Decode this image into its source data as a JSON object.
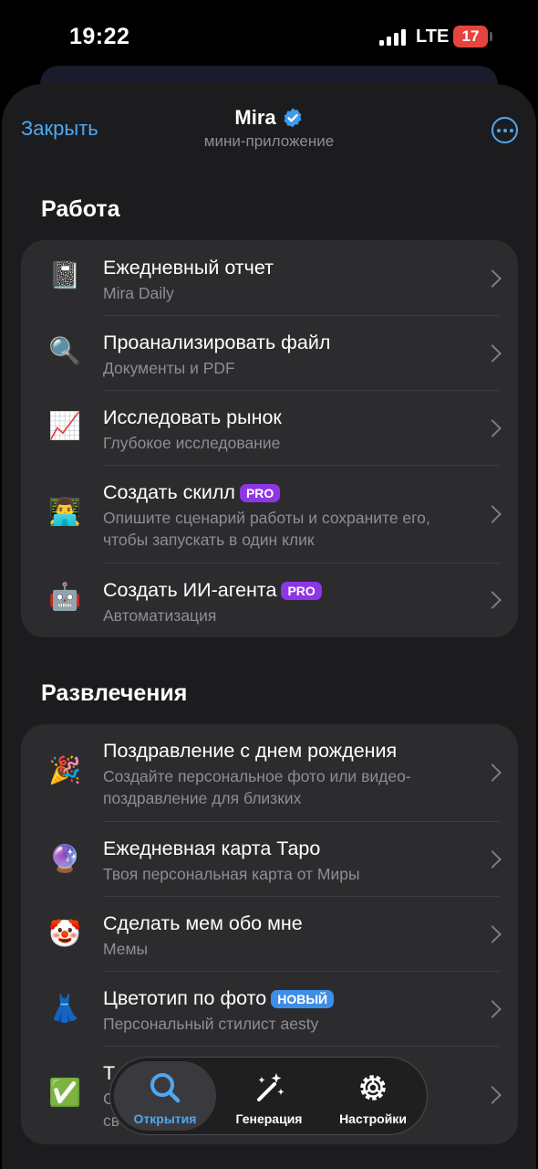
{
  "status_bar": {
    "time": "19:22",
    "network": "LTE",
    "battery": "17"
  },
  "header": {
    "close_label": "Закрыть",
    "app_name": "Mira",
    "subtitle": "мини-приложение",
    "verified_icon": "verified-check-icon",
    "more_icon": "ellipsis-icon"
  },
  "work": {
    "title": "Работа",
    "items": [
      {
        "emoji": "📓",
        "label": "Ежедневный отчет",
        "desc": "Mira Daily",
        "badge": ""
      },
      {
        "emoji": "🔍",
        "label": "Проанализировать файл",
        "desc": "Документы и PDF",
        "badge": ""
      },
      {
        "emoji": "📈",
        "label": "Исследовать рынок",
        "desc": "Глубокое исследование",
        "badge": ""
      },
      {
        "emoji": "👨‍💻",
        "label": "Создать скилл",
        "desc": "Опишите сценарий работы и сохраните его, чтобы запускать в один клик",
        "badge": "PRO"
      },
      {
        "emoji": "🤖",
        "label": "Создать ИИ-агента",
        "desc": "Автоматизация",
        "badge": "PRO"
      }
    ]
  },
  "fun": {
    "title": "Развлечения",
    "items": [
      {
        "emoji": "🎉",
        "label": "Поздравление с днем рождения",
        "desc": "Создайте персональное фото или видео-поздравление для близких",
        "badge": ""
      },
      {
        "emoji": "🔮",
        "label": "Ежедневная карта Таро",
        "desc": "Твоя персональная карта от Миры",
        "badge": ""
      },
      {
        "emoji": "🤡",
        "label": "Сделать мем обо мне",
        "desc": "Мемы",
        "badge": ""
      },
      {
        "emoji": "👗",
        "label": "Цветотип по фото",
        "desc": "Персональный стилист aesty",
        "badge": "НОВЫЙ"
      },
      {
        "emoji": "✅",
        "label": "Т",
        "desc": "С",
        "desc2": "св",
        "badge": ""
      }
    ]
  },
  "tabbar": {
    "tabs": [
      {
        "label": "Открытия",
        "icon": "search-icon",
        "active": true
      },
      {
        "label": "Генерация",
        "icon": "magic-wand-icon",
        "active": false
      },
      {
        "label": "Настройки",
        "icon": "gear-icon",
        "active": false
      }
    ]
  },
  "colors": {
    "accent": "#4fa8f0",
    "sheet_bg": "#1c1c1e",
    "card_bg": "#2c2c2e",
    "pro_badge": "#8e35e6",
    "new_badge": "#3d8ee6",
    "battery": "#e5453c"
  }
}
